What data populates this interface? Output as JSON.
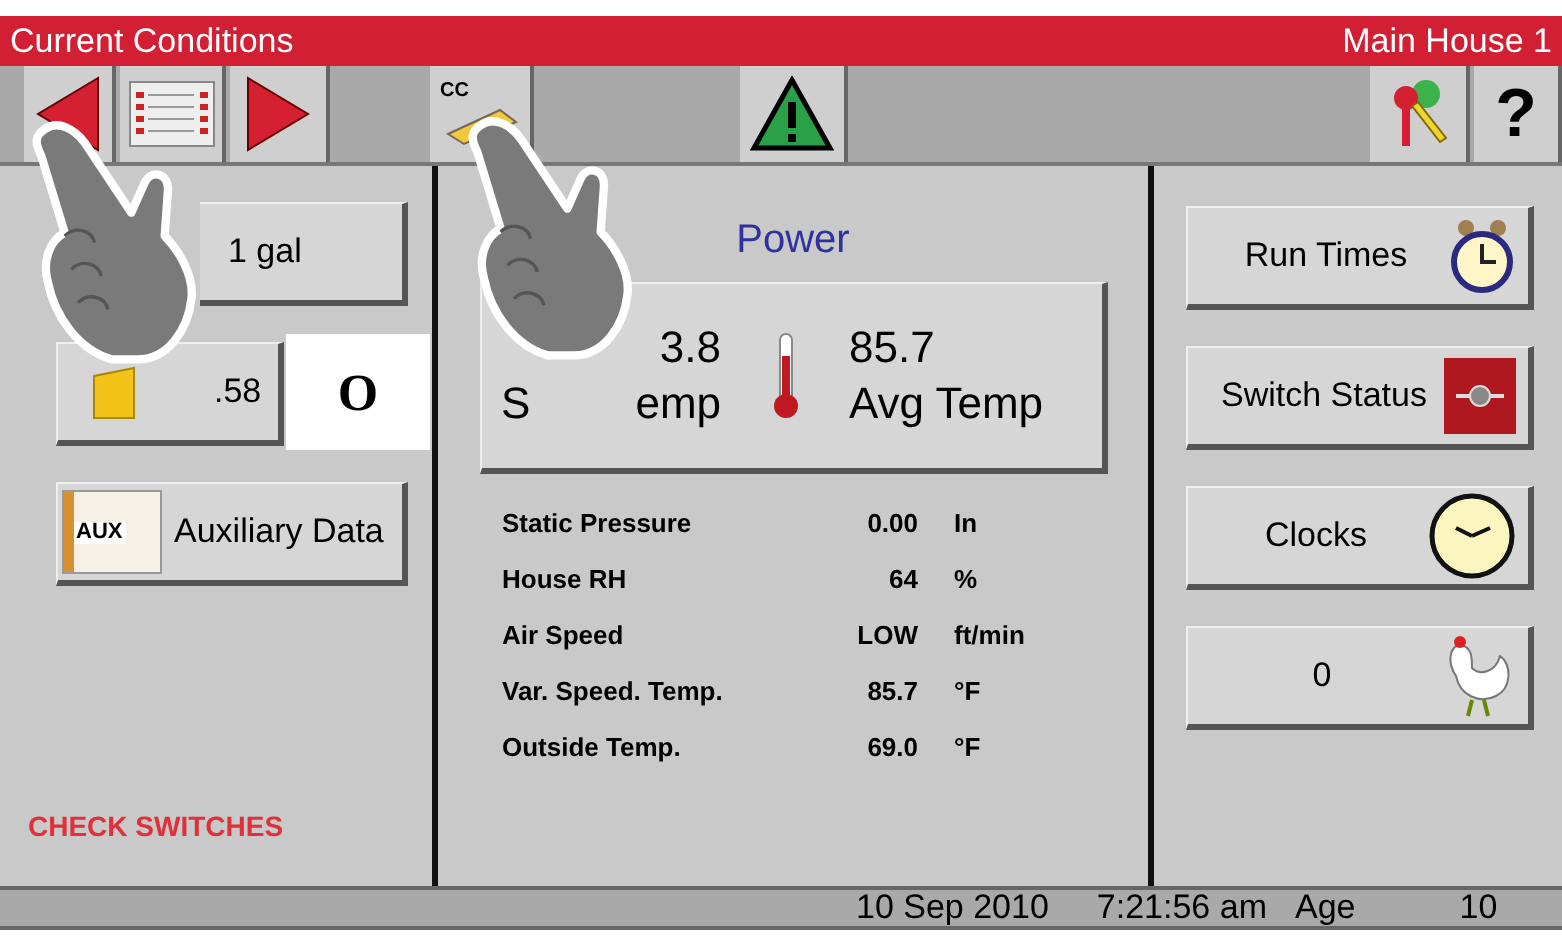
{
  "title_bar": {
    "title": "Current Conditions",
    "location": "Main House 1"
  },
  "toolbar": [
    {
      "items": [
        {
          "kind": "back"
        },
        {
          "kind": "sheet"
        },
        {
          "kind": "forward"
        }
      ]
    },
    {
      "items": [
        {
          "kind": "cc",
          "label": "CC"
        }
      ]
    },
    {
      "items": [
        {
          "kind": "alarm"
        }
      ]
    },
    {
      "items": [
        {
          "kind": "keys"
        },
        {
          "kind": "help",
          "label": "?"
        }
      ]
    }
  ],
  "left_buttons": [
    {
      "kind": "feed",
      "label": "1 gal"
    },
    {
      "kind": "water",
      "label": ".58"
    },
    {
      "kind": "aux",
      "label": "Auxiliary Data",
      "icon_label": "AUX"
    }
  ],
  "callout": "O",
  "alert": "CHECK SWITCHES",
  "power": {
    "title": "Power",
    "set_value": "3.8",
    "set_label_start": "S",
    "set_label_end": "emp",
    "avg_value": "85.7",
    "avg_label": "Avg Temp"
  },
  "readings": [
    {
      "label": "Static Pressure",
      "value": "0.00",
      "unit": "In"
    },
    {
      "label": "House RH",
      "value": "64",
      "unit": "%"
    },
    {
      "label": "Air Speed",
      "value": "LOW",
      "unit": "ft/min"
    },
    {
      "label": "Var. Speed. Temp.",
      "value": "85.7",
      "unit": "°F"
    },
    {
      "label": "Outside Temp.",
      "value": "69.0",
      "unit": "°F"
    }
  ],
  "right_buttons": [
    {
      "kind": "timer",
      "label": "Run Times"
    },
    {
      "kind": "switch",
      "label": "Switch Status"
    },
    {
      "kind": "clock",
      "label": "Clocks"
    },
    {
      "kind": "bird",
      "label": "0"
    }
  ],
  "status_bar": {
    "date": "10 Sep 2010",
    "time": "7:21:56 am",
    "age_label": "Age",
    "age_value": "10"
  }
}
